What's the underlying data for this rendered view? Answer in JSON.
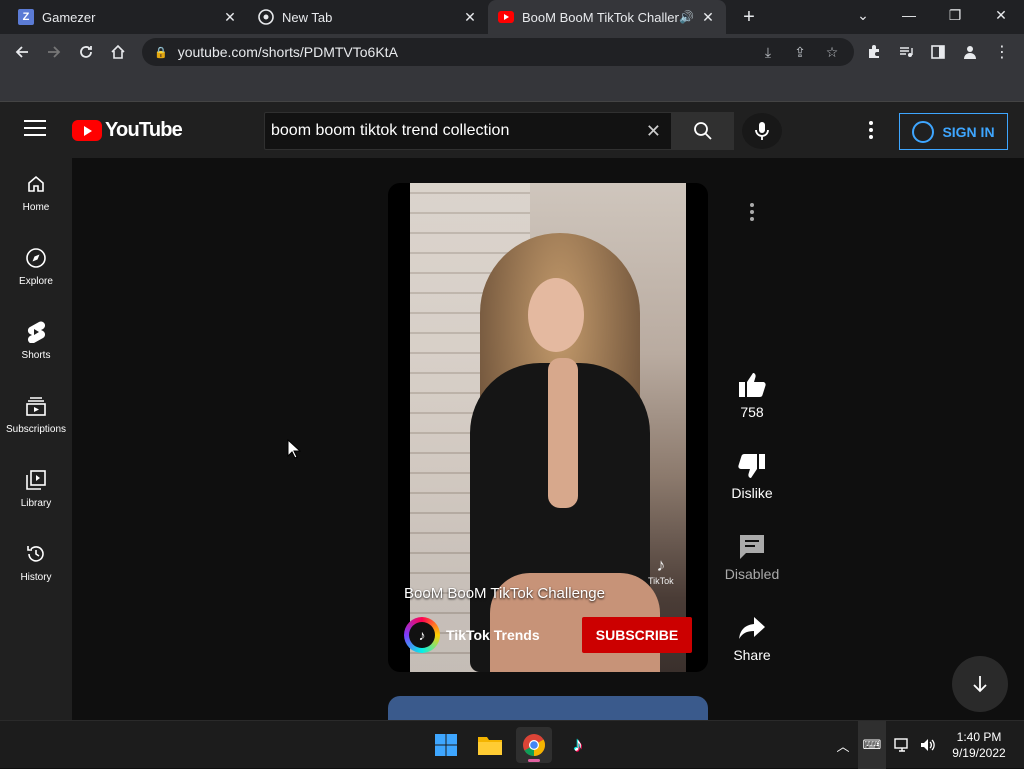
{
  "browser": {
    "tabs": [
      {
        "title": "Gamezer",
        "favicon": "Z"
      },
      {
        "title": "New Tab"
      },
      {
        "title": "BooM BooM TikTok Challeng"
      }
    ],
    "url": "youtube.com/shorts/PDMTVTo6KtA"
  },
  "youtube": {
    "logo_text": "YouTube",
    "search_value": "boom boom tiktok trend collection",
    "signin_label": "SIGN IN",
    "sidebar": [
      {
        "label": "Home",
        "icon": "home-icon"
      },
      {
        "label": "Explore",
        "icon": "compass-icon"
      },
      {
        "label": "Shorts",
        "icon": "shorts-icon"
      },
      {
        "label": "Subscriptions",
        "icon": "subscriptions-icon"
      },
      {
        "label": "Library",
        "icon": "library-icon"
      },
      {
        "label": "History",
        "icon": "history-icon"
      }
    ],
    "short": {
      "title": "BooM BooM TikTok Challenge",
      "channel": "TikTok Trends",
      "subscribe_label": "SUBSCRIBE",
      "watermark": "TikTok"
    },
    "actions": {
      "likes": "758",
      "dislike": "Dislike",
      "comments": "Disabled",
      "share": "Share"
    }
  },
  "taskbar": {
    "time": "1:40 PM",
    "date": "9/19/2022"
  },
  "colors": {
    "accent_red": "#ff0000",
    "subscribe_red": "#cc0000",
    "signin_blue": "#3ea6ff"
  }
}
